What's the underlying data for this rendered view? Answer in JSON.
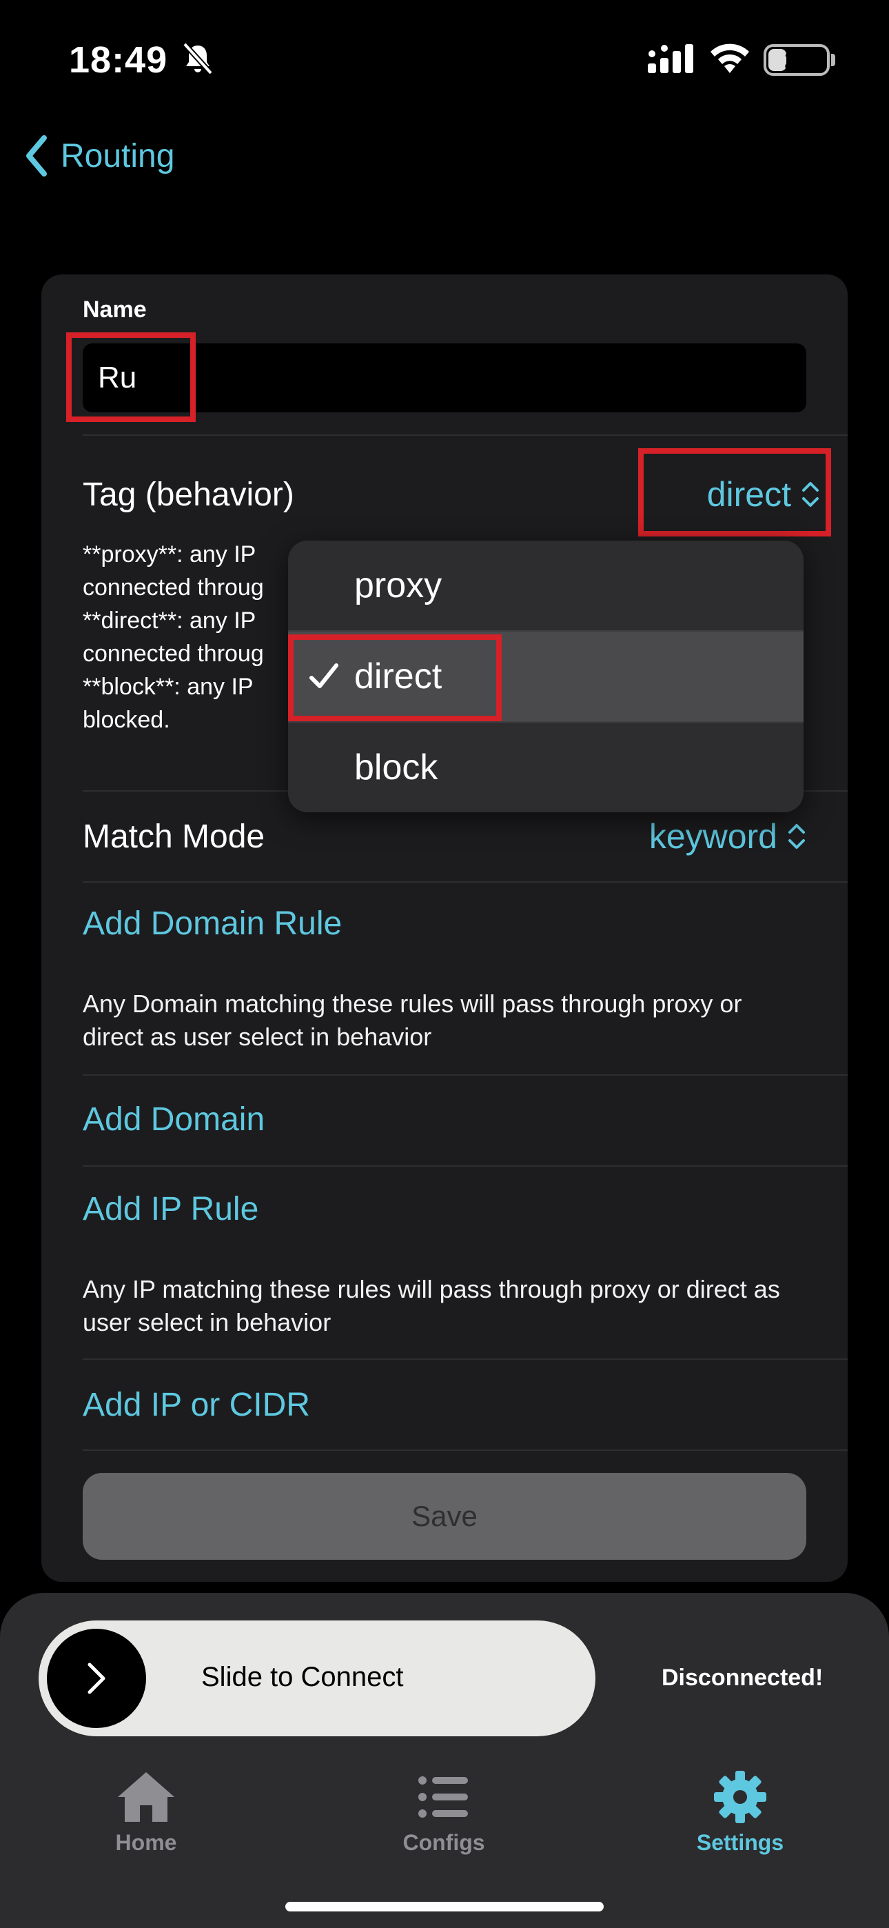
{
  "status_bar": {
    "time": "18:49",
    "battery": "28"
  },
  "nav": {
    "back_label": "Routing"
  },
  "form": {
    "name_label": "Name",
    "name_value": "Ru",
    "tag_label": "Tag (behavior)",
    "tag_value": "direct",
    "tag_description": "**proxy**: any IP\nconnected throug\n**direct**: any IP\nconnected throug\n**block**: any IP\nblocked.",
    "match_mode_label": "Match Mode",
    "match_mode_value": "keyword",
    "add_domain_rule": "Add Domain Rule",
    "domain_info": "Any Domain matching these rules will pass through proxy or direct as user select in behavior",
    "add_domain": "Add Domain",
    "add_ip_rule": "Add IP Rule",
    "ip_info": "Any IP matching these rules will pass through proxy or direct as user select in behavior",
    "add_ip": "Add IP or CIDR",
    "save_label": "Save"
  },
  "dropdown": {
    "options": [
      "proxy",
      "direct",
      "block"
    ],
    "selected": "direct"
  },
  "connect": {
    "slider_text": "Slide to Connect",
    "status": "Disconnected!"
  },
  "tabs": [
    {
      "label": "Home",
      "icon": "house-icon",
      "active": false
    },
    {
      "label": "Configs",
      "icon": "list-icon",
      "active": false
    },
    {
      "label": "Settings",
      "icon": "gear-icon",
      "active": true
    }
  ],
  "colors": {
    "accent": "#5ec8e0",
    "highlight": "#d52127",
    "card": "#1c1c1e"
  }
}
